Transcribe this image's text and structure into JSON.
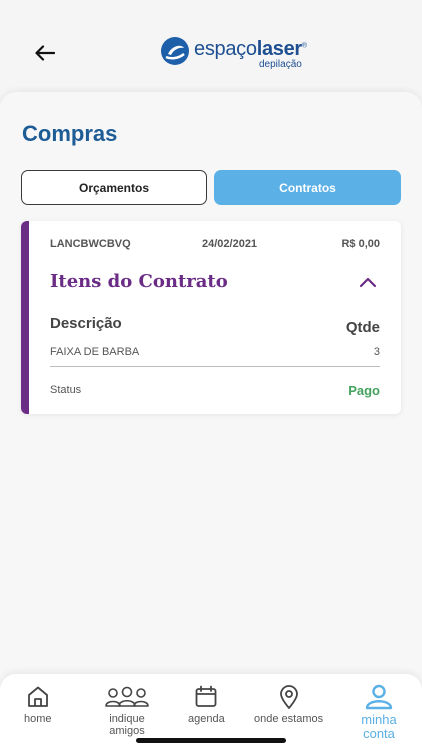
{
  "header": {
    "logo_word_light": "espaço",
    "logo_word_bold": "laser",
    "logo_sub": "depilação",
    "logo_registered": "®"
  },
  "page": {
    "title": "Compras"
  },
  "segments": [
    {
      "label": "Orçamentos",
      "active": false
    },
    {
      "label": "Contratos",
      "active": true
    }
  ],
  "contract": {
    "code": "LANCBWCBVQ",
    "date": "24/02/2021",
    "price": "R$ 0,00",
    "section_title": "Itens do Contrato",
    "desc_header": "Descrição",
    "qty_header": "Qtde",
    "items": [
      {
        "name": "FAIXA DE BARBA",
        "qty": "3"
      }
    ],
    "status_label": "Status",
    "status_value": "Pago"
  },
  "tabbar": {
    "tabs": [
      {
        "label": "home",
        "icon": "home-icon"
      },
      {
        "label": "indique amigos",
        "icon": "people-icon"
      },
      {
        "label": "agenda",
        "icon": "calendar-icon"
      },
      {
        "label": "onde estamos",
        "icon": "location-pin-icon"
      },
      {
        "label": "minha conta",
        "icon": "user-icon",
        "active": true
      }
    ]
  },
  "colors": {
    "brand_blue": "#1e5c96",
    "accent_purple": "#6b2c86",
    "active_tab": "#5bb0e6",
    "status_paid": "#43a25e"
  }
}
